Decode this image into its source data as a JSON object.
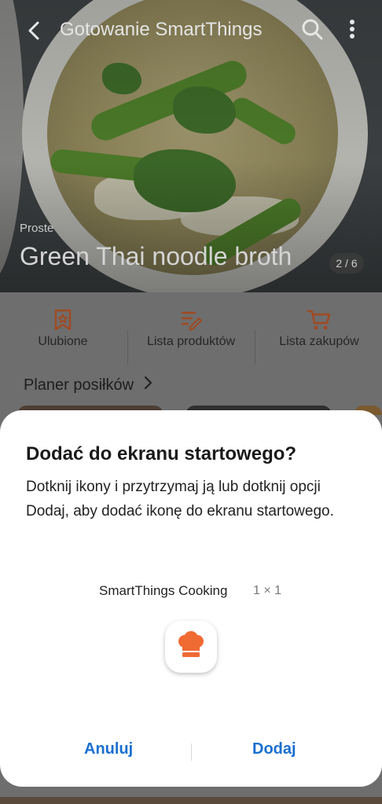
{
  "header": {
    "title": "Gotowanie SmartThings",
    "back_icon": "arrow-back-icon",
    "search_icon": "search-icon",
    "more_icon": "more-vertical-icon"
  },
  "hero": {
    "category": "Proste",
    "recipe_name": "Green Thai noodle broth",
    "pager": "2 / 6"
  },
  "actions": [
    {
      "label": "Ulubione",
      "icon": "bookmark-star-icon"
    },
    {
      "label": "Lista produktów",
      "icon": "edit-list-icon"
    },
    {
      "label": "Lista zakupów",
      "icon": "shopping-cart-icon"
    }
  ],
  "planner": {
    "label": "Planer posiłków",
    "icon": "chevron-right-icon"
  },
  "dialog": {
    "title": "Dodać do ekranu startowego?",
    "body": "Dotknij ikony i przytrzymaj ją lub dotknij opcji Dodaj, aby dodać ikonę do ekranu startowego.",
    "widget_name": "SmartThings Cooking",
    "widget_size": "1 × 1",
    "app_icon": "chef-hat-icon",
    "cancel": "Anuluj",
    "confirm": "Dodaj"
  },
  "colors": {
    "accent_orange": "#f06a33",
    "button_blue": "#1a6fd0",
    "dialog_bg": "#ffffff",
    "scrim": "#6e6e6e"
  }
}
